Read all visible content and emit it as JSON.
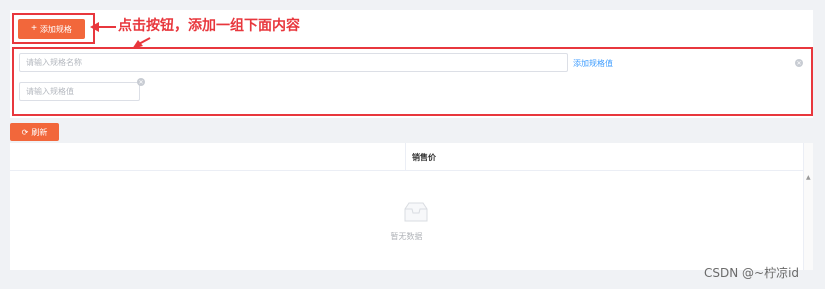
{
  "toolbar": {
    "add_spec_label": "添加规格",
    "refresh_label": "刷新"
  },
  "spec_group": {
    "name_placeholder": "请输入规格名称",
    "add_value_link": "添加规格值",
    "value_placeholder": "请输入规格值"
  },
  "annotation": {
    "text": "点击按钮，添加一组下面内容",
    "color": "#e8373d"
  },
  "table": {
    "columns": [
      "",
      "销售价"
    ],
    "empty_text": "暂无数据"
  },
  "watermark": "CSDN @~柠凉id",
  "colors": {
    "primary": "#f2673b",
    "link": "#409eff",
    "annotation": "#e8373d"
  }
}
